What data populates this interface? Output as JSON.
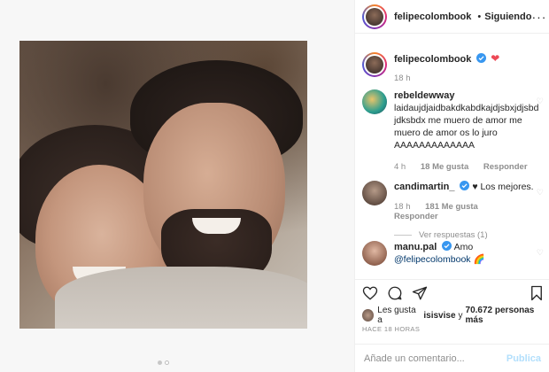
{
  "header": {
    "username": "felipecolombook",
    "separator": "•",
    "follow_status": "Siguiendo",
    "more": "···"
  },
  "caption": {
    "username": "felipecolombook",
    "text": "",
    "emoji": "❤",
    "time": "18 h"
  },
  "comments": [
    {
      "username": "rebeldewway",
      "verified": false,
      "text": "laidaujdjaidbakdkabdkajdjsbxjdjsbdjdksbdx me muero de amor me muero de amor os lo juro AAAAAAAAAAAAA",
      "time": "4 h",
      "likes": "18 Me gusta",
      "reply": "Responder"
    },
    {
      "username": "candimartin_",
      "verified": true,
      "text": "♥ Los mejores.",
      "time": "18 h",
      "likes": "181 Me gusta",
      "reply": "Responder",
      "view_replies": "Ver respuestas (1)"
    },
    {
      "username": "manu.pal",
      "verified": true,
      "text_pre": "Amo ",
      "mention": "@felipecolombook",
      "emoji": "🌈"
    }
  ],
  "likes": {
    "prefix": "Les gusta a ",
    "user": "isisvise",
    "middle": " y ",
    "count": "70.672 personas más"
  },
  "timestamp": "HACE 18 HORAS",
  "add_comment": {
    "placeholder": "Añade un comentario...",
    "publish": "Publica"
  },
  "colors": {
    "verified": "#3897f0",
    "heart": "#ed4956",
    "publish": "#b2dffc"
  }
}
